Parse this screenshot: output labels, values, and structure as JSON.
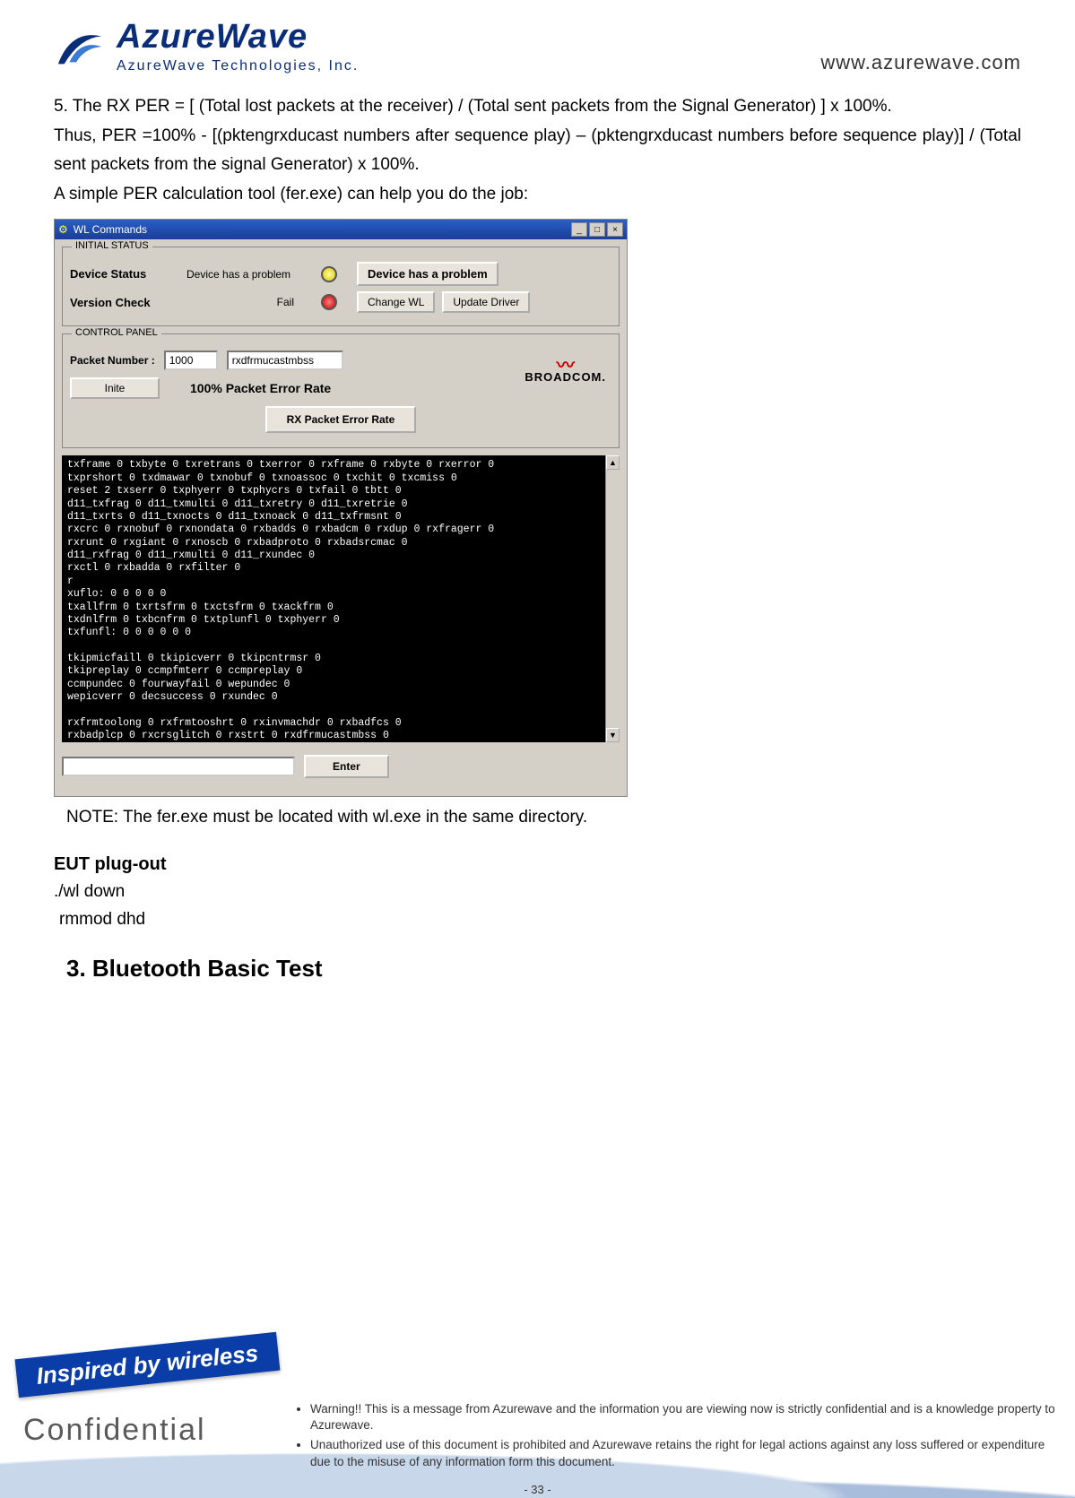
{
  "header": {
    "logo_main": "AzureWave",
    "logo_sub": "AzureWave  Technologies,  Inc.",
    "url": "www.azurewave.com"
  },
  "body": {
    "p1": "5. The RX PER = [ (Total lost packets at the receiver) / (Total sent packets from the Signal Generator) ] x 100%.",
    "p2": "Thus, PER =100% - [(pktengrxducast numbers after sequence play) – (pktengrxducast numbers before sequence play)] / (Total sent packets from the signal Generator) x 100%.",
    "p3": "A simple PER calculation tool (fer.exe) can help you do the job:"
  },
  "win": {
    "title": "WL Commands",
    "gb_initial": "INITIAL STATUS",
    "device_status_label": "Device Status",
    "device_status_value": "Device has a problem",
    "device_status_btn": "Device has a problem",
    "version_check_label": "Version Check",
    "version_check_value": "Fail",
    "change_wl_btn": "Change WL",
    "update_driver_btn": "Update Driver",
    "gb_control": "CONTROL PANEL",
    "packet_number_label": "Packet Number :",
    "packet_number_value": "1000",
    "counter_name": "rxdfrmucastmbss",
    "inite_btn": "Inite",
    "per_text": "100%   Packet Error Rate",
    "rx_per_btn": "RX Packet Error Rate",
    "broadcom": "BROADCOM.",
    "enter_btn": "Enter",
    "console": "txframe 0 txbyte 0 txretrans 0 txerror 0 rxframe 0 rxbyte 0 rxerror 0\ntxprshort 0 txdmawar 0 txnobuf 0 txnoassoc 0 txchit 0 txcmiss 0\nreset 2 txserr 0 txphyerr 0 txphycrs 0 txfail 0 tbtt 0\nd11_txfrag 0 d11_txmulti 0 d11_txretry 0 d11_txretrie 0\nd11_txrts 0 d11_txnocts 0 d11_txnoack 0 d11_txfrmsnt 0\nrxcrc 0 rxnobuf 0 rxnondata 0 rxbadds 0 rxbadcm 0 rxdup 0 rxfragerr 0\nrxrunt 0 rxgiant 0 rxnoscb 0 rxbadproto 0 rxbadsrcmac 0\nd11_rxfrag 0 d11_rxmulti 0 d11_rxundec 0\nrxctl 0 rxbadda 0 rxfilter 0\nr\nxuflo: 0 0 0 0 0\ntxallfrm 0 txrtsfrm 0 txctsfrm 0 txackfrm 0\ntxdnlfrm 0 txbcnfrm 0 txtplunfl 0 txphyerr 0\ntxfunfl: 0 0 0 0 0 0\n\ntkipmicfaill 0 tkipicverr 0 tkipcntrmsr 0\ntkipreplay 0 ccmpfmterr 0 ccmpreplay 0\nccmpundec 0 fourwayfail 0 wepundec 0\nwepicverr 0 decsuccess 0 rxundec 0\n\nrxfrmtoolong 0 rxfrmtooshrt 0 rxinvmachdr 0 rxbadfcs 0\nrxbadplcp 0 rxcrsglitch 0 rxstrt 0 rxdfrmucastmbss 0"
  },
  "note": "NOTE: The fer.exe must be located with wl.exe in the same directory.",
  "eut": {
    "heading": "EUT plug-out",
    "cmd1": "./wl down",
    "cmd2": "rmmod dhd"
  },
  "section3": "3. Bluetooth Basic Test",
  "footer": {
    "inspired": "Inspired by wireless",
    "confidential": "Confidential",
    "bullet1": "Warning!! This is a message from Azurewave and the information you are viewing now is strictly confidential and is a knowledge property to Azurewave.",
    "bullet2": "Unauthorized use of this document is prohibited and Azurewave retains the right for legal actions against any loss suffered or expenditure due to the misuse of any information form this document.",
    "page_num": "- 33 -"
  }
}
